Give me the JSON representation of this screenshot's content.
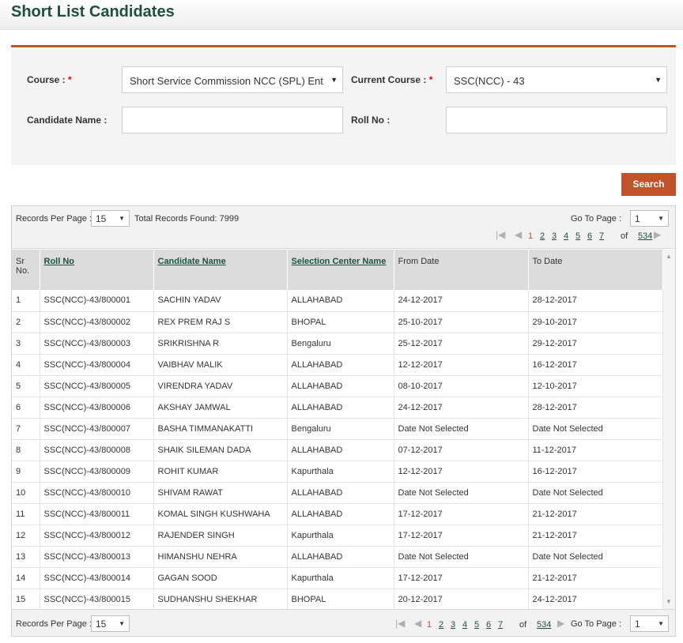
{
  "page": {
    "title": "Short List Candidates"
  },
  "filters": {
    "course_label": "Course :",
    "course_value": "Short Service Commission NCC (SPL) Ent",
    "current_course_label": "Current Course :",
    "current_course_value": "SSC(NCC) - 43",
    "candidate_name_label": "Candidate Name :",
    "candidate_name_value": "",
    "roll_no_label": "Roll No :",
    "roll_no_value": "",
    "required_mark": "*",
    "search_label": "Search"
  },
  "pager": {
    "records_per_page_label": "Records Per Page :",
    "records_per_page": "15",
    "total_records_text": "Total Records Found: 7999",
    "go_to_page_label": "Go To Page :",
    "go_to_page": "1",
    "pages": [
      "1",
      "2",
      "3",
      "4",
      "5",
      "6",
      "7"
    ],
    "current_page": "1",
    "of_label": "of",
    "total_pages": "534"
  },
  "table": {
    "columns": [
      "Sr No.",
      "Roll No",
      "Candidate Name",
      "Selection Center Name",
      "From Date",
      "To Date"
    ],
    "rows": [
      [
        "1",
        "SSC(NCC)-43/800001",
        "SACHIN YADAV",
        "ALLAHABAD",
        "24-12-2017",
        "28-12-2017"
      ],
      [
        "2",
        "SSC(NCC)-43/800002",
        "REX PREM RAJ S",
        "BHOPAL",
        "25-10-2017",
        "29-10-2017"
      ],
      [
        "3",
        "SSC(NCC)-43/800003",
        "SRIKRISHNA R",
        "Bengaluru",
        "25-12-2017",
        "29-12-2017"
      ],
      [
        "4",
        "SSC(NCC)-43/800004",
        "VAIBHAV MALIK",
        "ALLAHABAD",
        "12-12-2017",
        "16-12-2017"
      ],
      [
        "5",
        "SSC(NCC)-43/800005",
        "VIRENDRA YADAV",
        "ALLAHABAD",
        "08-10-2017",
        "12-10-2017"
      ],
      [
        "6",
        "SSC(NCC)-43/800006",
        "AKSHAY JAMWAL",
        "ALLAHABAD",
        "24-12-2017",
        "28-12-2017"
      ],
      [
        "7",
        "SSC(NCC)-43/800007",
        "BASHA TIMMANAKATTI",
        "Bengaluru",
        "Date Not Selected",
        "Date Not Selected"
      ],
      [
        "8",
        "SSC(NCC)-43/800008",
        "SHAIK SILEMAN DADA",
        "ALLAHABAD",
        "07-12-2017",
        "11-12-2017"
      ],
      [
        "9",
        "SSC(NCC)-43/800009",
        "ROHIT KUMAR",
        "Kapurthala",
        "12-12-2017",
        "16-12-2017"
      ],
      [
        "10",
        "SSC(NCC)-43/800010",
        "SHIVAM RAWAT",
        "ALLAHABAD",
        "Date Not Selected",
        "Date Not Selected"
      ],
      [
        "11",
        "SSC(NCC)-43/800011",
        "KOMAL SINGH KUSHWAHA",
        "ALLAHABAD",
        "17-12-2017",
        "21-12-2017"
      ],
      [
        "12",
        "SSC(NCC)-43/800012",
        "RAJENDER SINGH",
        "Kapurthala",
        "17-12-2017",
        "21-12-2017"
      ],
      [
        "13",
        "SSC(NCC)-43/800013",
        "HIMANSHU NEHRA",
        "ALLAHABAD",
        "Date Not Selected",
        "Date Not Selected"
      ],
      [
        "14",
        "SSC(NCC)-43/800014",
        "GAGAN SOOD",
        "Kapurthala",
        "17-12-2017",
        "21-12-2017"
      ],
      [
        "15",
        "SSC(NCC)-43/800015",
        "SUDHANSHU SHEKHAR",
        "BHOPAL",
        "20-12-2017",
        "24-12-2017"
      ]
    ]
  },
  "colors": {
    "accent": "#c0532a",
    "title": "#1f4f3d",
    "panel": "#f4f4f4",
    "header": "#dcdcdc"
  },
  "icons": {
    "dropdown": "chevron-down-icon",
    "first": "first-page-icon",
    "prev": "prev-page-icon",
    "next": "next-page-icon",
    "last": "last-page-icon"
  }
}
